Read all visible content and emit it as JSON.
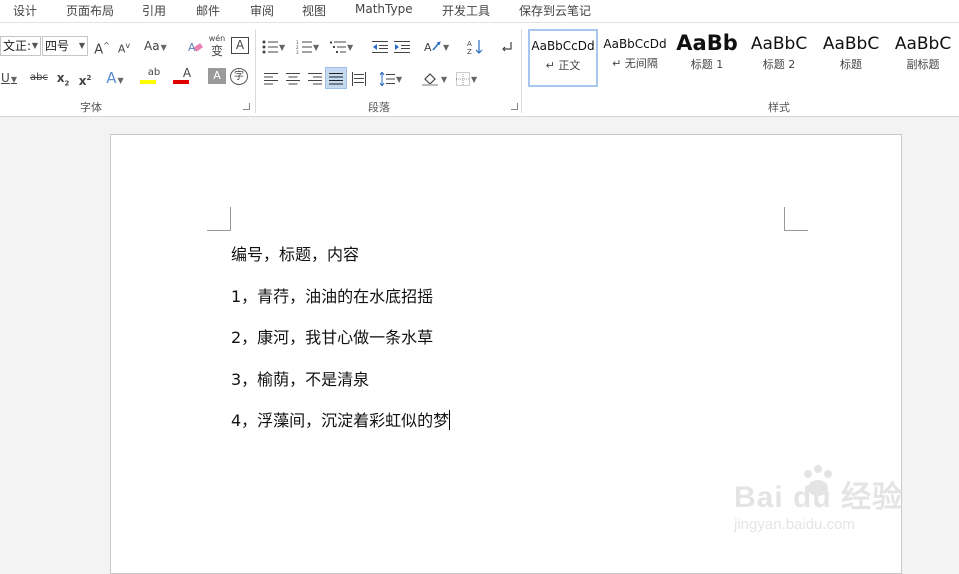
{
  "menu": {
    "tabs": [
      {
        "label": "设计"
      },
      {
        "label": "页面布局"
      },
      {
        "label": "引用"
      },
      {
        "label": "邮件"
      },
      {
        "label": "审阅"
      },
      {
        "label": "视图"
      },
      {
        "label": "MathType"
      },
      {
        "label": "开发工具"
      },
      {
        "label": "保存到云笔记"
      }
    ]
  },
  "ribbon": {
    "font": {
      "group_label": "字体",
      "font_name": "文正:",
      "font_size": "四号",
      "grow_label": "A",
      "shrink_label": "A",
      "case_label": "Aa",
      "phonetic_label": "wén",
      "phonetic_char": "变",
      "border_char": "A",
      "underline_label": "U",
      "strike_label": "abc",
      "subscript_label": "x",
      "subscript_mark": "2",
      "superscript_label": "x",
      "superscript_mark": "2",
      "effects_label": "A",
      "highlight_label": "ab",
      "font_color_label": "A",
      "shading_char_label": "A",
      "enclose_char_label": "字",
      "highlight_color": "#ffff00",
      "font_color": "#e00000"
    },
    "paragraph": {
      "group_label": "段落"
    },
    "styles": {
      "group_label": "样式",
      "items": [
        {
          "preview": "AaBbCcDd",
          "name": "正文",
          "marker": "↵"
        },
        {
          "preview": "AaBbCcDd",
          "name": "无间隔",
          "marker": "↵"
        },
        {
          "preview": "AaBb",
          "name": "标题 1"
        },
        {
          "preview": "AaBbC",
          "name": "标题 2"
        },
        {
          "preview": "AaBbC",
          "name": "标题"
        },
        {
          "preview": "AaBbC",
          "name": "副标题"
        }
      ]
    }
  },
  "document": {
    "lines": [
      "编号，标题，内容",
      "1，青荇，油油的在水底招摇",
      "2，康河，我甘心做一条水草",
      "3，榆荫，不是清泉",
      "4，浮藻间，沉淀着彩虹似的梦"
    ]
  },
  "watermark": {
    "logo_text": "Bai  du 经验",
    "url": "jingyan.baidu.com"
  }
}
